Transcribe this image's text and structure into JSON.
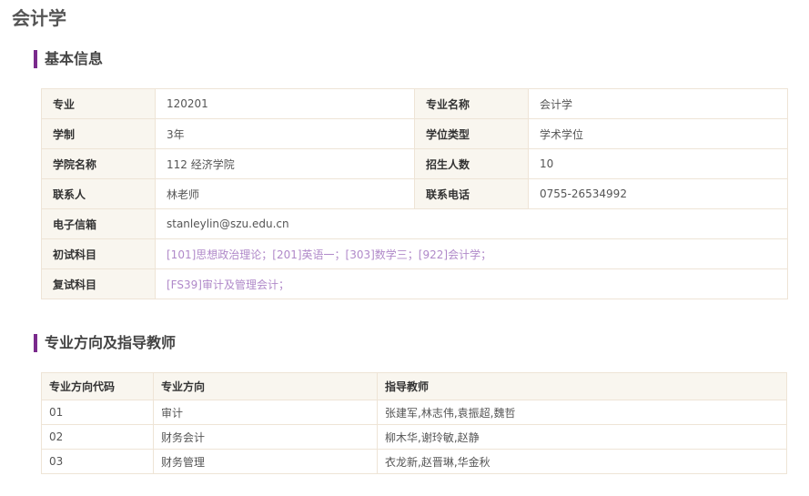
{
  "page": {
    "title": "会计学"
  },
  "basic_info": {
    "heading": "基本信息",
    "major_code_label": "专业",
    "major_code": "120201",
    "major_name_label": "专业名称",
    "major_name": "会计学",
    "duration_label": "学制",
    "duration": "3年",
    "degree_type_label": "学位类型",
    "degree_type": "学术学位",
    "college_label": "学院名称",
    "college": "112 经济学院",
    "enrollment_label": "招生人数",
    "enrollment": "10",
    "contact_label": "联系人",
    "contact": "林老师",
    "phone_label": "联系电话",
    "phone": "0755-26534992",
    "email_label": "电子信箱",
    "email": "stanleylin@szu.edu.cn",
    "prelim_label": "初试科目",
    "prelim_subjects": "[101]思想政治理论；[201]英语一；[303]数学三；[922]会计学；",
    "retest_label": "复试科目",
    "retest_subjects": "[FS39]审计及管理会计；"
  },
  "directions": {
    "heading": "专业方向及指导教师",
    "columns": [
      "专业方向代码",
      "专业方向",
      "指导教师"
    ],
    "rows": [
      {
        "code": "01",
        "name": "审计",
        "advisors": "张建军,林志伟,袁振超,魏哲"
      },
      {
        "code": "02",
        "name": "财务会计",
        "advisors": "柳木华,谢玲敏,赵静"
      },
      {
        "code": "03",
        "name": "财务管理",
        "advisors": "衣龙新,赵晋琳,华金秋"
      }
    ]
  },
  "colors": {
    "accent": "#7a2a8c",
    "link": "#b089c9",
    "label_bg": "#f9f6ef",
    "border": "#eee4d6"
  }
}
